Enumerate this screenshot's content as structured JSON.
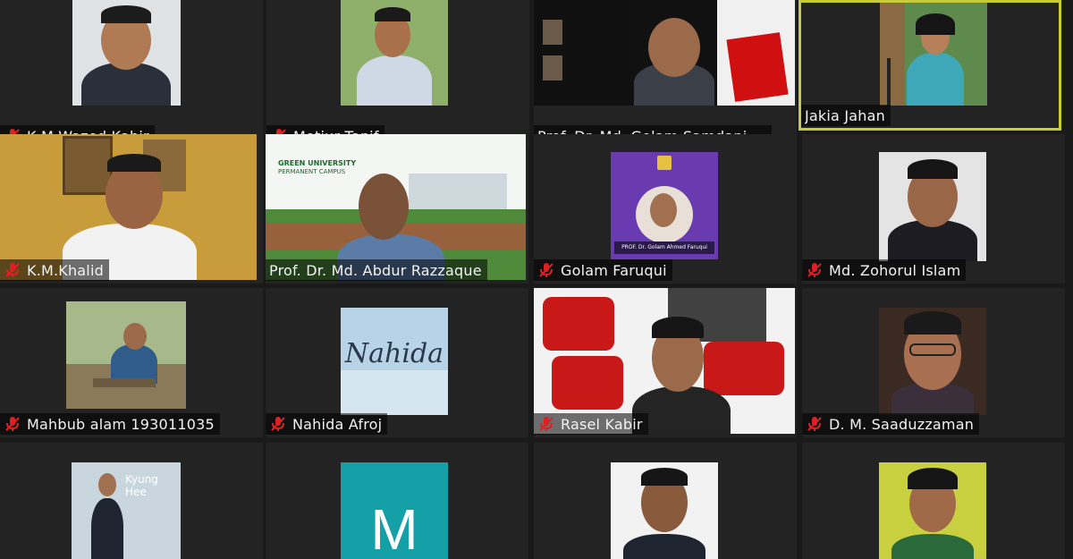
{
  "participants": [
    {
      "name": "K.M Wazed Kabir",
      "muted": true
    },
    {
      "name": "Motiur Tanif",
      "muted": true
    },
    {
      "name": "Prof. Dr. Md. Golam Samdani ...",
      "muted": false
    },
    {
      "name": "Jakia Jahan",
      "muted": false,
      "active_speaker": true
    },
    {
      "name": "K.M.Khalid",
      "muted": true
    },
    {
      "name": "Prof. Dr. Md. Abdur Razzaque",
      "muted": false
    },
    {
      "name": "Golam Faruqui",
      "muted": true
    },
    {
      "name": "Md. Zohorul Islam",
      "muted": true
    },
    {
      "name": "Mahbub alam 193011035",
      "muted": true
    },
    {
      "name": "Nahida Afroj",
      "muted": true
    },
    {
      "name": "Rasel Kabir",
      "muted": true
    },
    {
      "name": "D. M. Saaduzzaman",
      "muted": true
    },
    {
      "name": "",
      "muted": false
    },
    {
      "name": "",
      "muted": false
    },
    {
      "name": "",
      "muted": false
    },
    {
      "name": "",
      "muted": false
    }
  ],
  "tile_text": {
    "nahida_avatar": "Nahida",
    "m_avatar": "M",
    "green_university": "GREEN UNIVERSITY",
    "permanent_campus": "PERMANENT CAMPUS",
    "kyung_hee": "Kyung Hee",
    "poster_caption": "PROF. Dr. Golam Ahmed Faruqui"
  },
  "colors": {
    "active_border": "#c8cc3c",
    "muted_icon": "#e02020",
    "background": "#1a1a1a"
  }
}
